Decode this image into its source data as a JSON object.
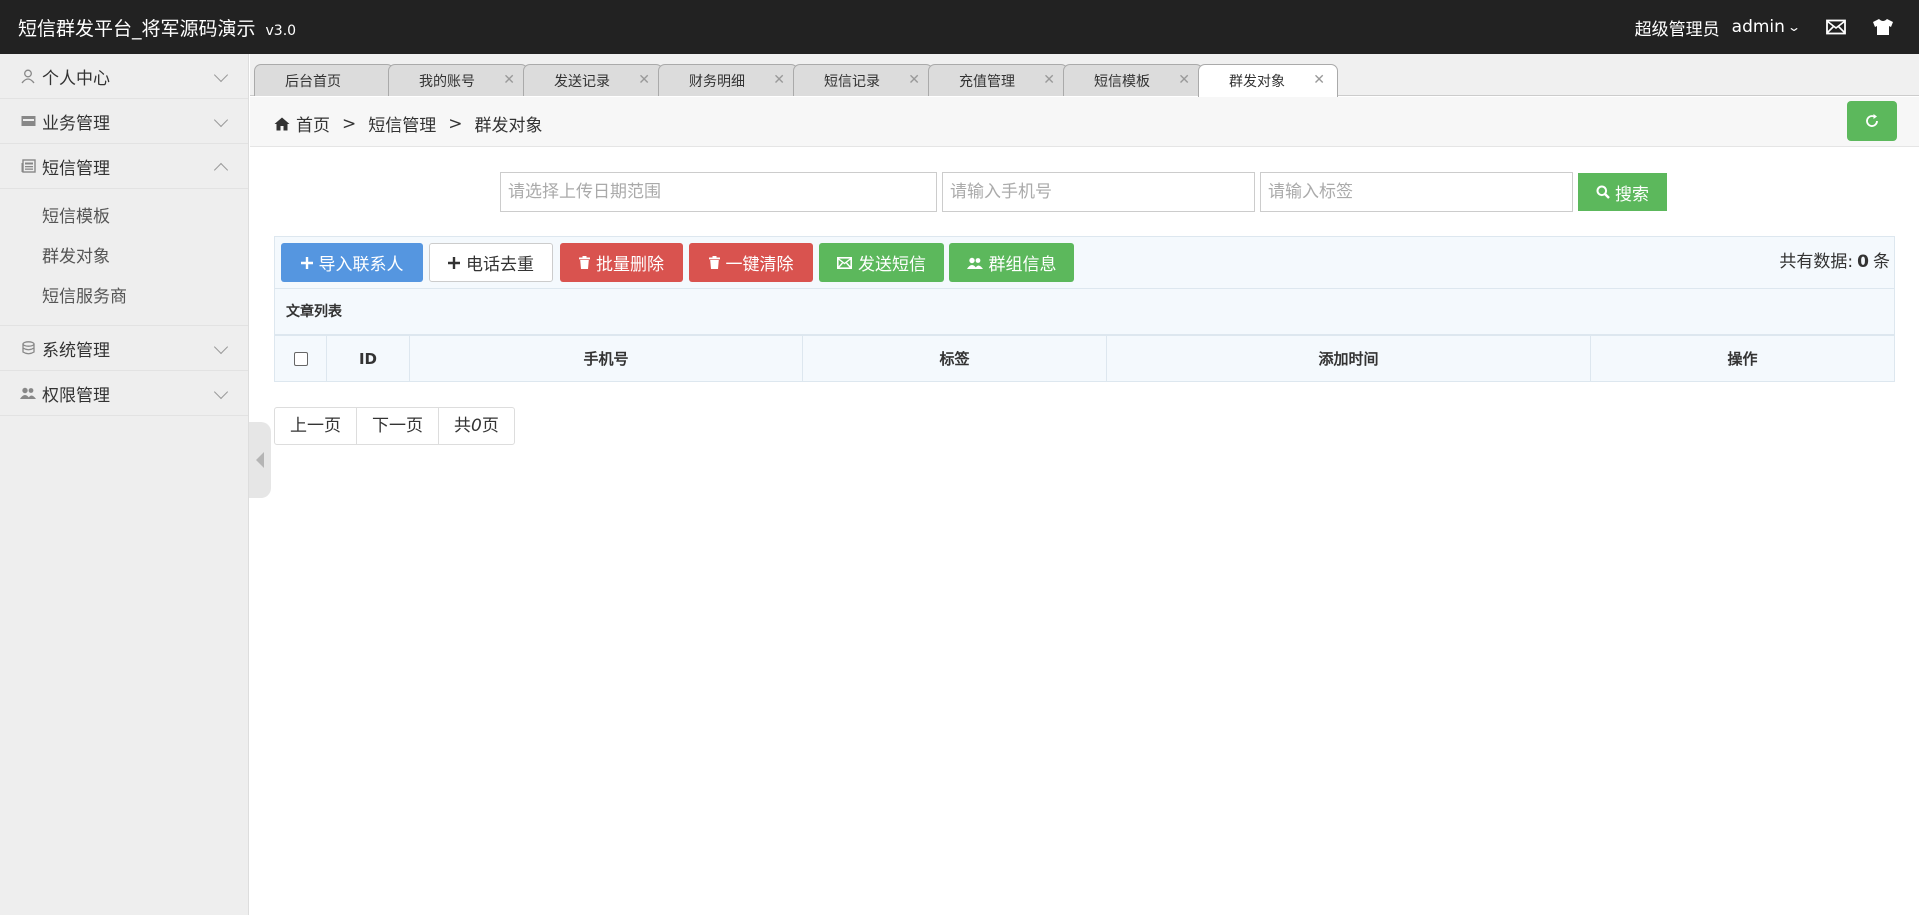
{
  "header": {
    "title": "短信群发平台_将军源码演示",
    "version": "v3.0",
    "role": "超级管理员",
    "username": "admin",
    "icons": [
      "mail-icon",
      "tshirt-icon"
    ]
  },
  "sidebar": {
    "groups": [
      {
        "label": "个人中心",
        "icon": "user-icon"
      },
      {
        "label": "业务管理",
        "icon": "card-icon"
      },
      {
        "label": "短信管理",
        "icon": "newspaper-icon",
        "expanded": true,
        "children": [
          "短信模板",
          "群发对象",
          "短信服务商"
        ]
      },
      {
        "label": "系统管理",
        "icon": "database-icon"
      },
      {
        "label": "权限管理",
        "icon": "users-icon"
      }
    ]
  },
  "tabs": [
    {
      "label": "后台首页",
      "closable": false
    },
    {
      "label": "我的账号",
      "closable": true
    },
    {
      "label": "发送记录",
      "closable": true
    },
    {
      "label": "财务明细",
      "closable": true
    },
    {
      "label": "短信记录",
      "closable": true
    },
    {
      "label": "充值管理",
      "closable": true
    },
    {
      "label": "短信模板",
      "closable": true
    },
    {
      "label": "群发对象",
      "closable": true,
      "active": true
    }
  ],
  "breadcrumb": {
    "home": "首页",
    "level1": "短信管理",
    "level2": "群发对象",
    "separator": ">"
  },
  "search": {
    "date_placeholder": "请选择上传日期范围",
    "phone_placeholder": "请输入手机号",
    "tag_placeholder": "请输入标签",
    "button": "搜索"
  },
  "toolbar": {
    "import": "导入联系人",
    "dedupe": "电话去重",
    "batch_delete": "批量删除",
    "clear_all": "一键清除",
    "send_sms": "发送短信",
    "group_info": "群组信息",
    "total_prefix": "共有数据:",
    "total_count": "0",
    "total_suffix": "条"
  },
  "table": {
    "title": "文章列表",
    "columns": [
      "ID",
      "手机号",
      "标签",
      "添加时间",
      "操作"
    ],
    "rows": []
  },
  "pager": {
    "prev": "上一页",
    "next": "下一页",
    "total_prefix": "共",
    "total_pages": "0",
    "total_suffix": "页"
  },
  "colors": {
    "header_bg": "#222222",
    "primary_blue": "#5596e0",
    "danger_red": "#d9534f",
    "success_green": "#5cb85c"
  }
}
